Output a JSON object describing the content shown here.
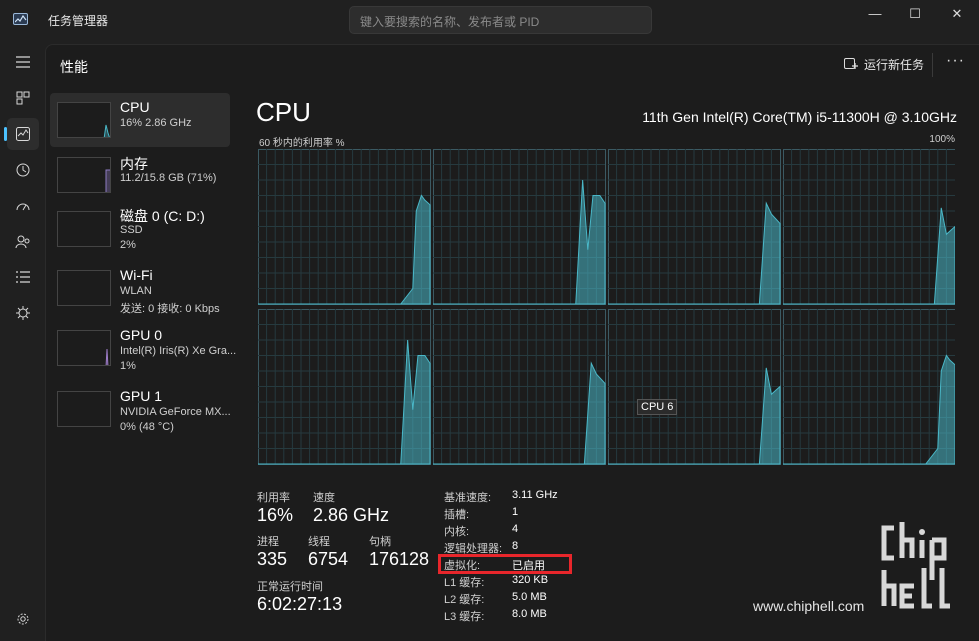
{
  "window": {
    "title": "任务管理器",
    "search_placeholder": "键入要搜索的名称、发布者或 PID",
    "minimize": "—",
    "maximize": "☐",
    "close": "✕"
  },
  "header": {
    "page_title": "性能",
    "run_new_task": "运行新任务",
    "more": "···"
  },
  "perf_list": [
    {
      "name": "CPU",
      "sub1": "16%  2.86 GHz",
      "sub2": "",
      "color": "#4ab8c8"
    },
    {
      "name": "内存",
      "sub1": "11.2/15.8 GB (71%)",
      "sub2": "",
      "color": "#8e7cc3"
    },
    {
      "name": "磁盘 0 (C: D:)",
      "sub1": "SSD",
      "sub2": "2%",
      "color": "#5fb878"
    },
    {
      "name": "Wi-Fi",
      "sub1": "WLAN",
      "sub2": "发送: 0 接收: 0 Kbps",
      "color": "#c08cc0"
    },
    {
      "name": "GPU 0",
      "sub1": "Intel(R) Iris(R) Xe Gra...",
      "sub2": "1%",
      "color": "#9d7cc8"
    },
    {
      "name": "GPU 1",
      "sub1": "NVIDIA GeForce MX...",
      "sub2": "0% (48 °C)",
      "color": "#9d7cc8"
    }
  ],
  "cpu": {
    "title": "CPU",
    "model": "11th Gen Intel(R) Core(TM) i5-11300H @ 3.10GHz",
    "graph_label": "60 秒内的利用率 %",
    "graph_max": "100%",
    "tooltip": "CPU 6",
    "graph_color": "#4ab8c8"
  },
  "stats": {
    "util_label": "利用率",
    "util_val": "16%",
    "speed_label": "速度",
    "speed_val": "2.86 GHz",
    "proc_label": "进程",
    "proc_val": "335",
    "thread_label": "线程",
    "thread_val": "6754",
    "handle_label": "句柄",
    "handle_val": "176128",
    "uptime_label": "正常运行时间",
    "uptime_val": "6:02:27:13"
  },
  "specs": [
    {
      "label": "基准速度:",
      "value": "3.11 GHz"
    },
    {
      "label": "插槽:",
      "value": "1"
    },
    {
      "label": "内核:",
      "value": "4"
    },
    {
      "label": "逻辑处理器:",
      "value": "8"
    },
    {
      "label": "虚拟化:",
      "value": "已启用"
    },
    {
      "label": "L1 缓存:",
      "value": "320 KB"
    },
    {
      "label": "L2 缓存:",
      "value": "5.0 MB"
    },
    {
      "label": "L3 缓存:",
      "value": "8.0 MB"
    }
  ],
  "watermark": {
    "url": "www.chiphell.com",
    "logo_top": "chip",
    "logo_bottom": "hell"
  }
}
